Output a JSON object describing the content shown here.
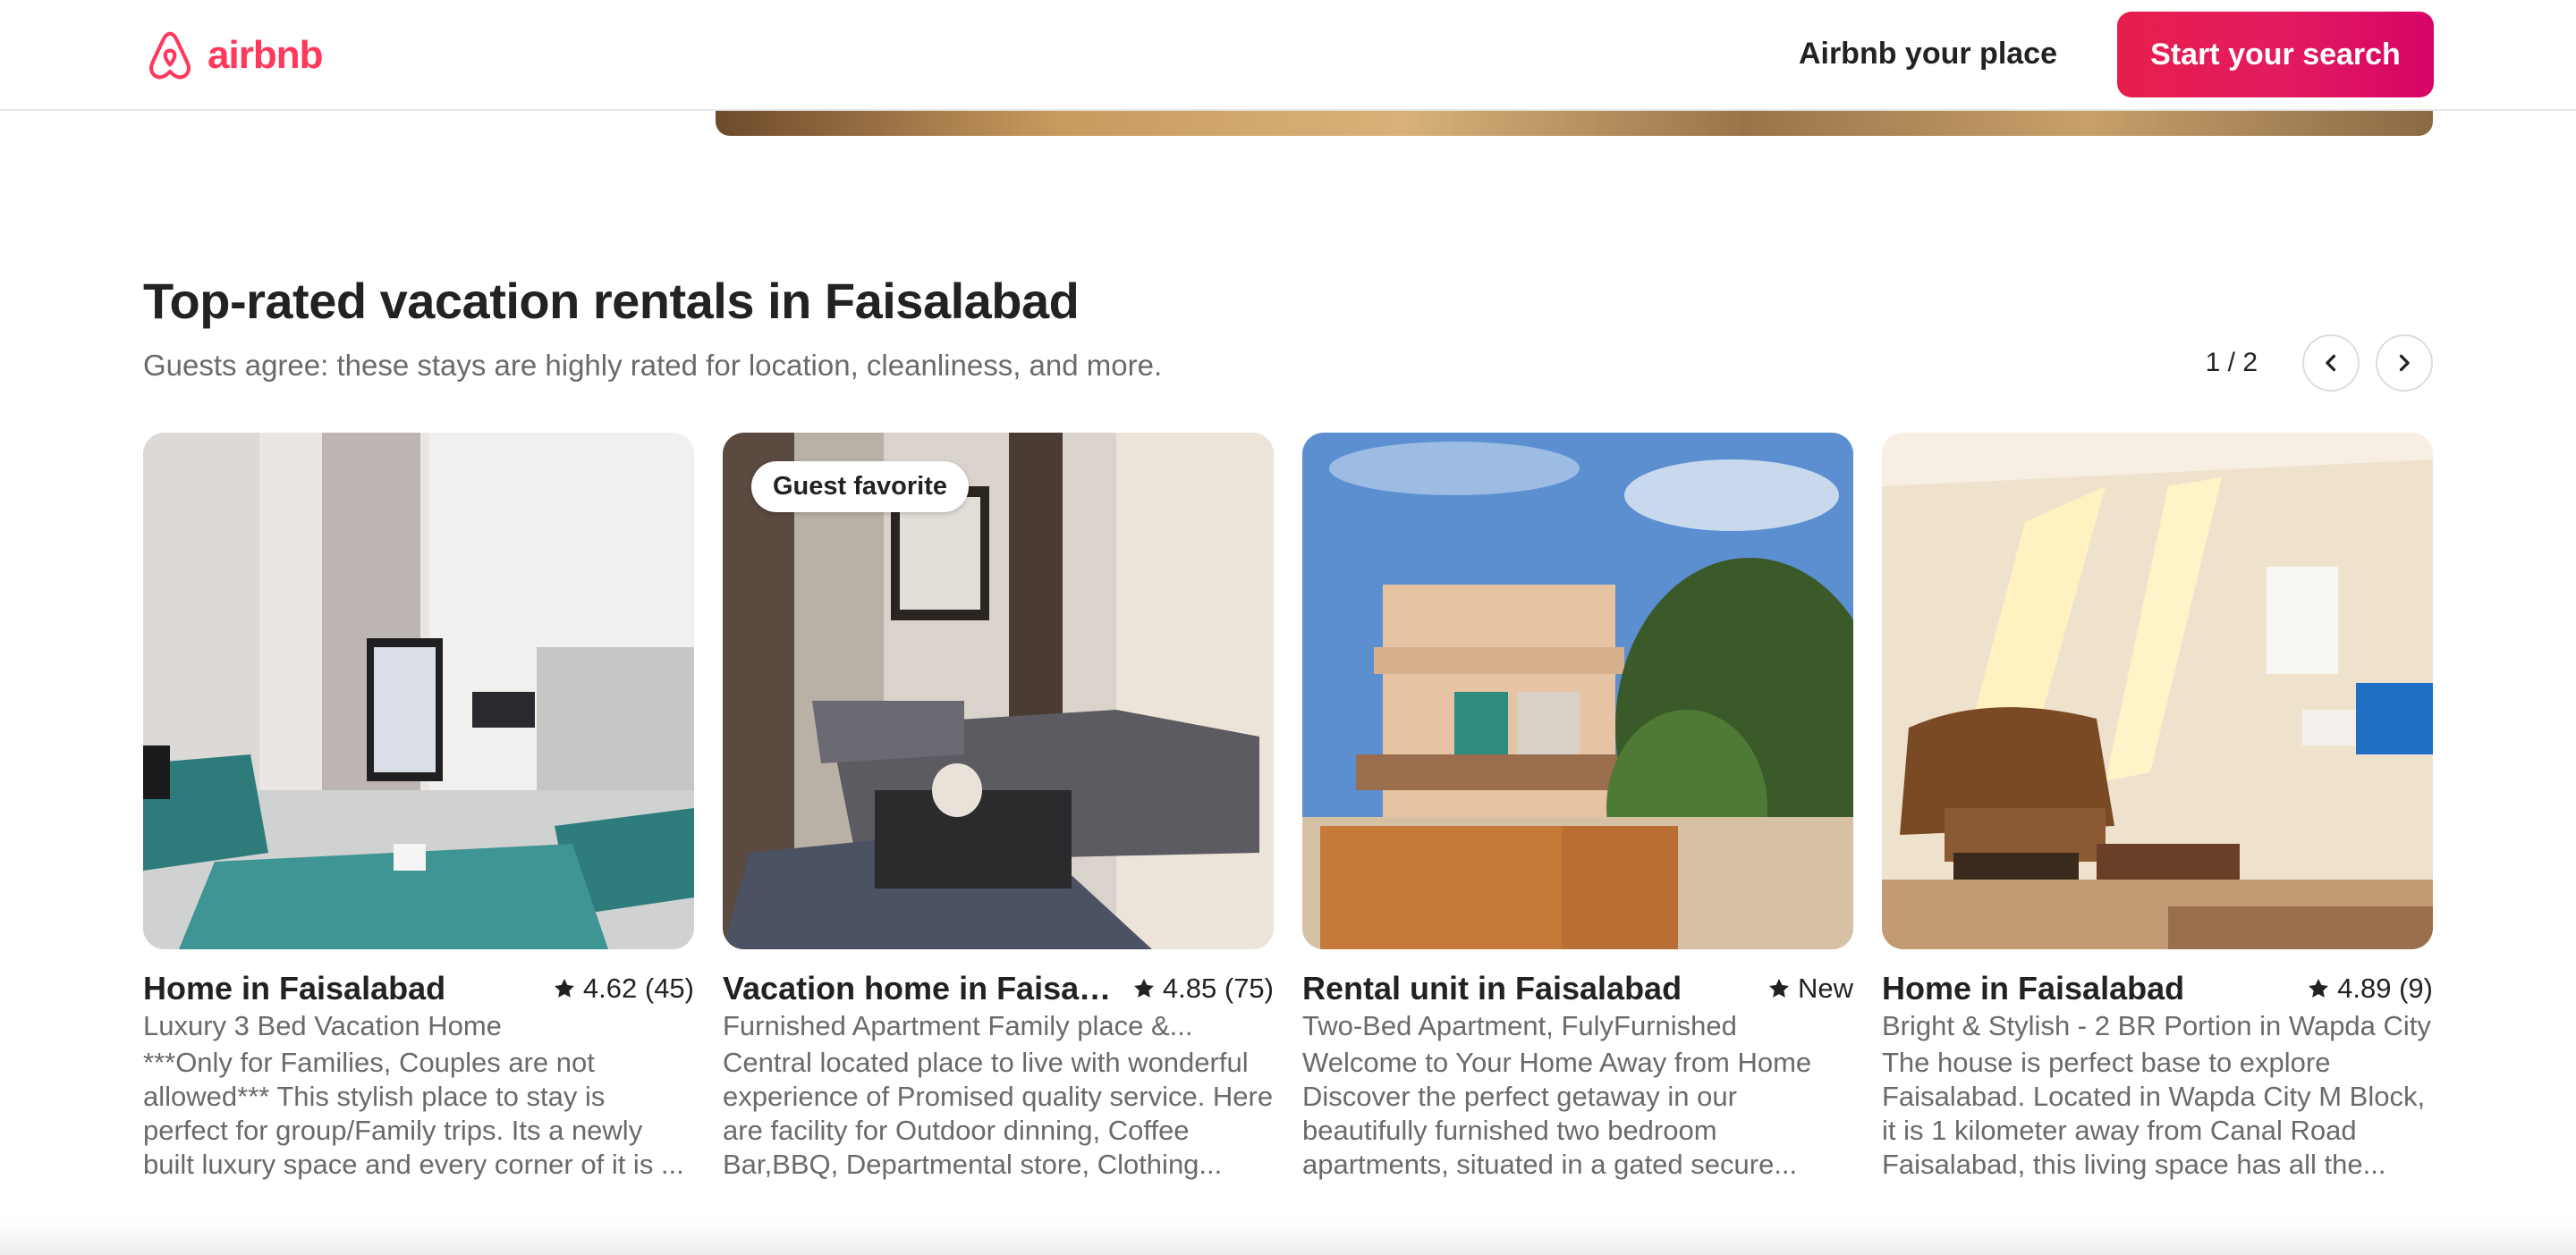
{
  "header": {
    "logo_text": "airbnb",
    "host_link": "Airbnb your place",
    "search_button": "Start your search",
    "brand_color": "#ff385c"
  },
  "section": {
    "title": "Top-rated vacation rentals in Faisalabad",
    "subtitle": "Guests agree: these stays are highly rated for location, cleanliness, and more.",
    "page_indicator": "1 / 2",
    "prev_icon": "chevron-left-icon",
    "next_icon": "chevron-right-icon"
  },
  "listings": [
    {
      "title": "Home in Faisalabad",
      "rating": "4.62 (45)",
      "subtitle": "Luxury 3 Bed Vacation Home",
      "description": "***Only for Families, Couples are not allowed*** This stylish place to stay is perfect for group/Family trips. Its a newly built luxury space and every corner of it is ..."
    },
    {
      "badge": "Guest favorite",
      "title": "Vacation home in Faisala...",
      "rating": "4.85 (75)",
      "subtitle": "Furnished Apartment Family place &...",
      "description": "Central located place to live with wonderful experience of Promised quality service. Here are facility for Outdoor dinning, Coffee Bar,BBQ, Departmental store, Clothing..."
    },
    {
      "title": "Rental unit in Faisalabad",
      "rating": "New",
      "subtitle": "Two-Bed Apartment, FulyFurnished",
      "description": "Welcome to Your Home Away from Home Discover the perfect getaway in our beautifully furnished two bedroom apartments, situated in a gated secure..."
    },
    {
      "title": "Home in Faisalabad",
      "rating": "4.89 (9)",
      "subtitle": "Bright & Stylish - 2 BR Portion in Wapda City",
      "description": "The house is perfect base to explore Faisalabad. Located in Wapda City M Block, it is 1 kilometer away from Canal Road Faisalabad, this living space has all the..."
    }
  ]
}
